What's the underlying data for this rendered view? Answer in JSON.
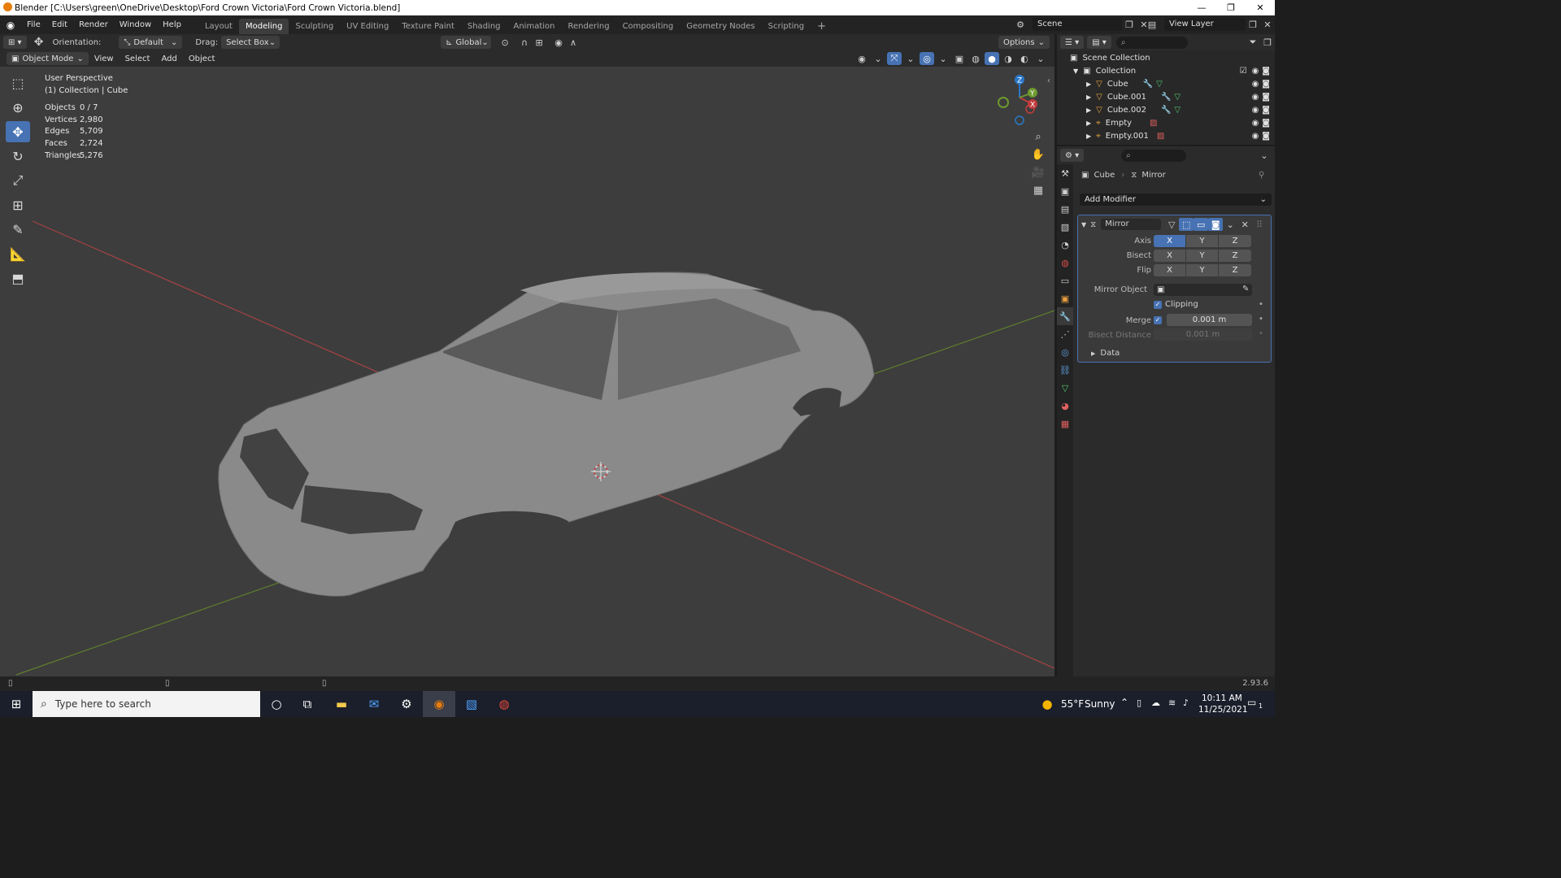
{
  "window": {
    "title": "Blender [C:\\Users\\green\\OneDrive\\Desktop\\Ford Crown Victoria\\Ford Crown Victoria.blend]",
    "minimize": "—",
    "maximize": "❐",
    "close": "✕"
  },
  "menu": {
    "items": [
      "File",
      "Edit",
      "Render",
      "Window",
      "Help"
    ]
  },
  "workspaces": {
    "tabs": [
      "Layout",
      "Modeling",
      "Sculpting",
      "UV Editing",
      "Texture Paint",
      "Shading",
      "Animation",
      "Rendering",
      "Compositing",
      "Geometry Nodes",
      "Scripting"
    ],
    "active": "Modeling",
    "add": "+"
  },
  "scene": {
    "name": "Scene",
    "view_layer": "View Layer"
  },
  "tool_header": {
    "orientation_label": "Orientation:",
    "orientation_value": "Default",
    "drag_label": "Drag:",
    "drag_value": "Select Box",
    "transform": "Global",
    "options": "Options"
  },
  "view_header": {
    "mode": "Object Mode",
    "items": [
      "View",
      "Select",
      "Add",
      "Object"
    ]
  },
  "viewport": {
    "perspective": "User Perspective",
    "collection": "(1) Collection | Cube",
    "stats": [
      {
        "label": "Objects",
        "value": "0 / 7"
      },
      {
        "label": "Vertices",
        "value": "2,980"
      },
      {
        "label": "Edges",
        "value": "5,709"
      },
      {
        "label": "Faces",
        "value": "2,724"
      },
      {
        "label": "Triangles",
        "value": "5,276"
      }
    ],
    "gizmo": {
      "x": "X",
      "y": "Y",
      "z": "Z"
    }
  },
  "outliner": {
    "root": "Scene Collection",
    "collection": "Collection",
    "items": [
      "Cube",
      "Cube.001",
      "Cube.002",
      "Empty",
      "Empty.001"
    ]
  },
  "properties": {
    "breadcrumb_object": "Cube",
    "breadcrumb_modifier": "Mirror",
    "add_modifier": "Add Modifier",
    "modifier_name": "Mirror",
    "axis_label": "Axis",
    "bisect_label": "Bisect",
    "flip_label": "Flip",
    "x": "X",
    "y": "Y",
    "z": "Z",
    "mirror_object_label": "Mirror Object",
    "clipping_label": "Clipping",
    "merge_label": "Merge",
    "merge_value": "0.001 m",
    "bisect_distance_label": "Bisect Distance",
    "bisect_distance_value": "0.001 m",
    "data_label": "Data"
  },
  "statusbar": {
    "version": "2.93.6"
  },
  "taskbar": {
    "search_placeholder": "Type here to search",
    "weather_temp": "55°F",
    "weather_cond": "Sunny",
    "time": "10:11 AM",
    "date": "11/25/2021",
    "notifications": "1"
  },
  "colors": {
    "accent": "#4772b3",
    "viewport_bg": "#3d3d3d",
    "x_axis": "#c24a4a",
    "y_axis": "#6e9a2e"
  }
}
